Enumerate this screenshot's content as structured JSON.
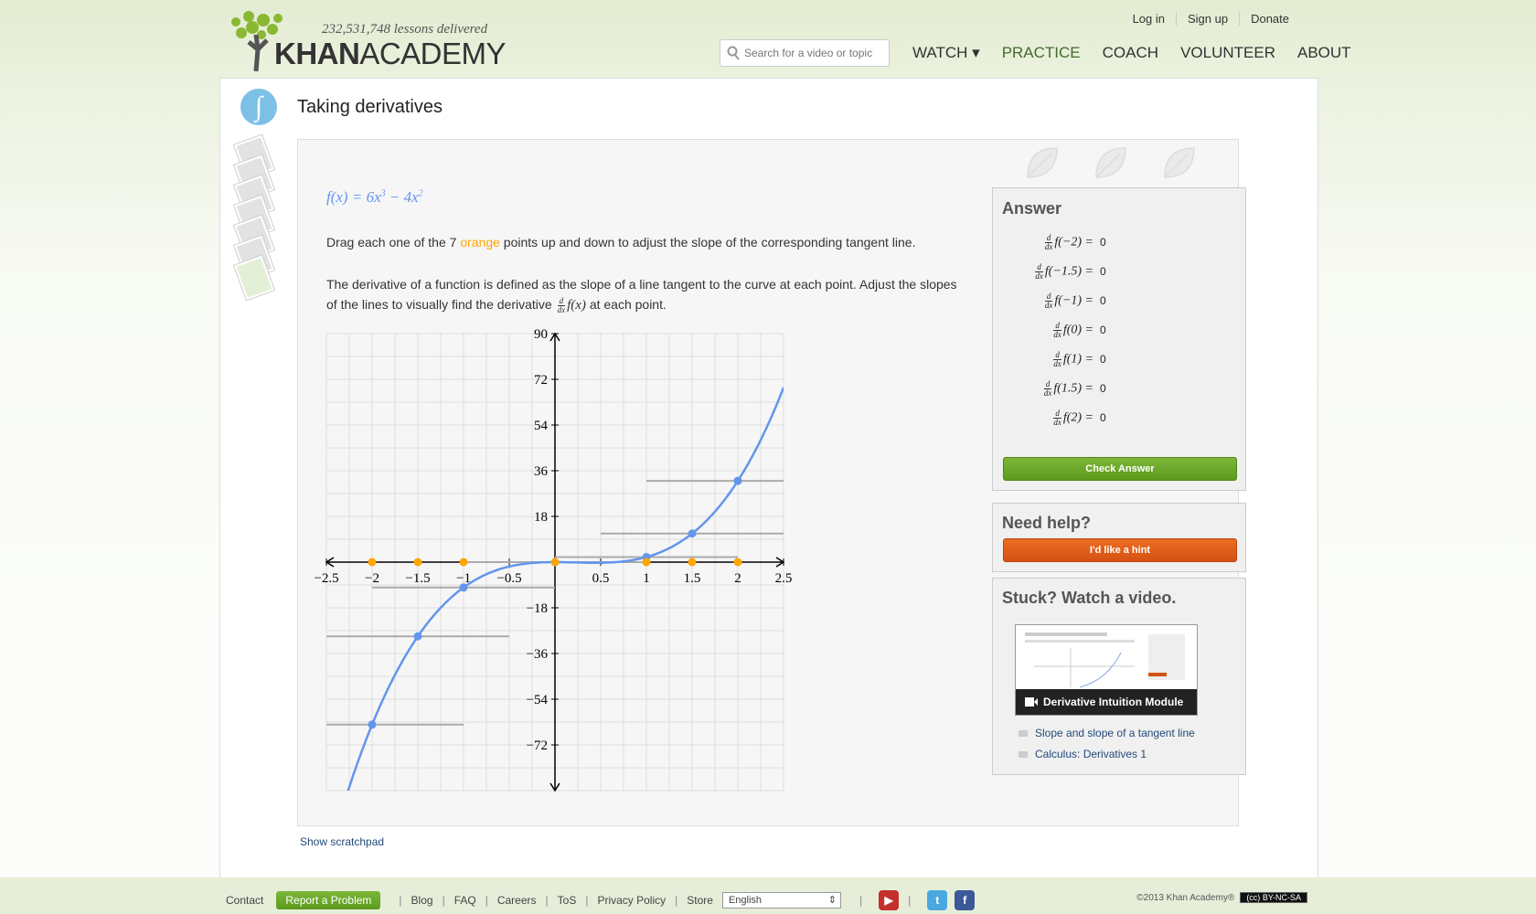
{
  "header": {
    "lessons_delivered": "232,531,748 lessons delivered",
    "brand_bold": "KHAN",
    "brand_rest": "ACADEMY",
    "top_links": [
      "Log in",
      "Sign up",
      "Donate"
    ],
    "search_placeholder": "Search for a video or topic",
    "nav": [
      {
        "label": "WATCH ▾"
      },
      {
        "label": "PRACTICE"
      },
      {
        "label": "COACH"
      },
      {
        "label": "VOLUNTEER"
      },
      {
        "label": "ABOUT"
      }
    ]
  },
  "exercise": {
    "title": "Taking derivatives",
    "title_icon": "∫",
    "function_text": "f(x) = 6x",
    "instruction_pre": "Drag each one of the 7 ",
    "instruction_orange": "orange",
    "instruction_post": " points up and down to adjust the slope of the corresponding tangent line.",
    "para2_pre": "The derivative of a function is defined as the slope of a line tangent to the curve at each point. Adjust the slopes of the lines to visually find the derivative",
    "para2_post": "at each point.",
    "scratchpad": "Show scratchpad"
  },
  "answer": {
    "heading": "Answer",
    "rows": [
      {
        "label": "f(−2) =",
        "value": "0"
      },
      {
        "label": "f(−1.5) =",
        "value": "0"
      },
      {
        "label": "f(−1) =",
        "value": "0"
      },
      {
        "label": "f(0) =",
        "value": "0"
      },
      {
        "label": "f(1) =",
        "value": "0"
      },
      {
        "label": "f(1.5) =",
        "value": "0"
      },
      {
        "label": "f(2) =",
        "value": "0"
      }
    ],
    "check_button": "Check Answer"
  },
  "help": {
    "heading": "Need help?",
    "hint_button": "I'd like a hint"
  },
  "video": {
    "heading": "Stuck? Watch a video.",
    "featured": "Derivative Intuition Module",
    "links": [
      "Slope and slope of a tangent line",
      "Calculus: Derivatives 1"
    ]
  },
  "footer": {
    "contact": "Contact",
    "report": "Report a Problem",
    "links": [
      "Blog",
      "FAQ",
      "Careers",
      "ToS",
      "Privacy Policy",
      "Store"
    ],
    "language": "English",
    "copyright": "©2013 Khan Academy®",
    "license": "BY-NC-SA"
  },
  "colors": {
    "curve": "#6495ed",
    "orange_points": "#ffa500",
    "green_button": "#5c9a1c",
    "orange_button": "#d45212"
  },
  "chart_data": {
    "type": "line",
    "function": "6x^3 - 4x^2",
    "xlim": [
      -2.5,
      2.5
    ],
    "ylim": [
      -90,
      90
    ],
    "x_ticks": [
      -2.5,
      -2,
      -1.5,
      -1,
      -0.5,
      0.5,
      1,
      1.5,
      2,
      2.5
    ],
    "x_tick_labels": [
      "−2.5",
      "−2",
      "−1.5",
      "−1",
      "−0.5",
      "0.5",
      "1",
      "1.5",
      "2",
      "2.5"
    ],
    "y_ticks": [
      90,
      72,
      54,
      36,
      18,
      -18,
      -36,
      -54,
      -72
    ],
    "y_tick_labels": [
      "90",
      "72",
      "54",
      "36",
      "18",
      "−18",
      "−36",
      "−54",
      "−72"
    ],
    "points_x": [
      -2,
      -1.5,
      -1,
      0,
      1,
      1.5,
      2
    ],
    "curve_points_y": [
      -64,
      -29.25,
      -10,
      0,
      2,
      11.25,
      32
    ],
    "orange_points_y": [
      0,
      0,
      0,
      0,
      0,
      0,
      0
    ],
    "tangent_slopes": [
      0,
      0,
      0,
      0,
      0,
      0,
      0
    ],
    "grid": true
  }
}
